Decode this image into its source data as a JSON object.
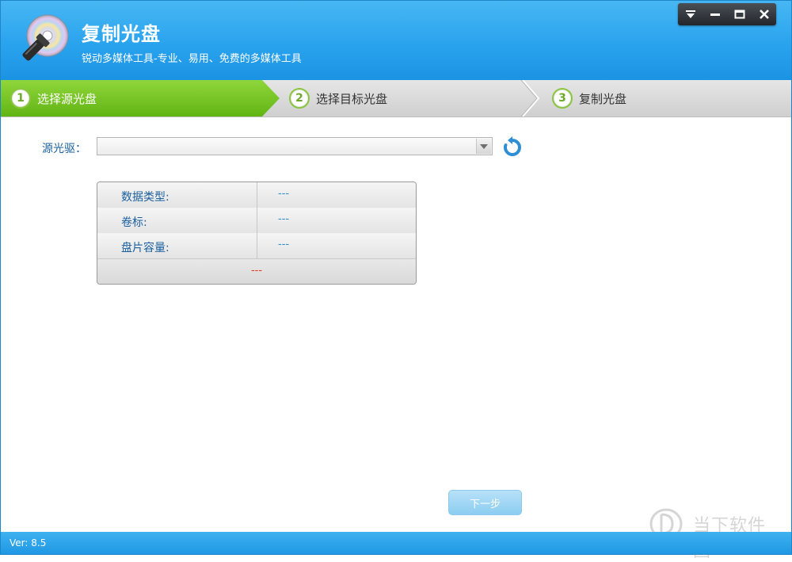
{
  "app": {
    "title": "复制光盘",
    "subtitle": "锐动多媒体工具-专业、易用、免费的多媒体工具",
    "logo_icon": "cd-flashlight-icon"
  },
  "window_controls": {
    "menu_icon": "dropdown-menu-icon",
    "minimize_icon": "minimize-icon",
    "maximize_icon": "maximize-icon",
    "close_icon": "close-icon"
  },
  "steps": [
    {
      "number": "1",
      "label": "选择源光盘",
      "active": true
    },
    {
      "number": "2",
      "label": "选择目标光盘",
      "active": false
    },
    {
      "number": "3",
      "label": "复制光盘",
      "active": false
    }
  ],
  "source": {
    "label": "源光驱：",
    "selected": "",
    "refresh_icon": "refresh-icon"
  },
  "info": {
    "rows": [
      {
        "key": "数据类型:",
        "value": "---"
      },
      {
        "key": "卷标:",
        "value": "---"
      },
      {
        "key": "盘片容量:",
        "value": "---"
      }
    ],
    "footer": "---"
  },
  "next_button": {
    "label": "下一步"
  },
  "watermark": {
    "text": "当下软件园"
  },
  "status": {
    "version": "Ver: 8.5"
  },
  "colors": {
    "header": "#2aa3ee",
    "step_active": "#62b414",
    "accent_text": "#1a5f9e",
    "footer_value": "#e23b1a"
  }
}
